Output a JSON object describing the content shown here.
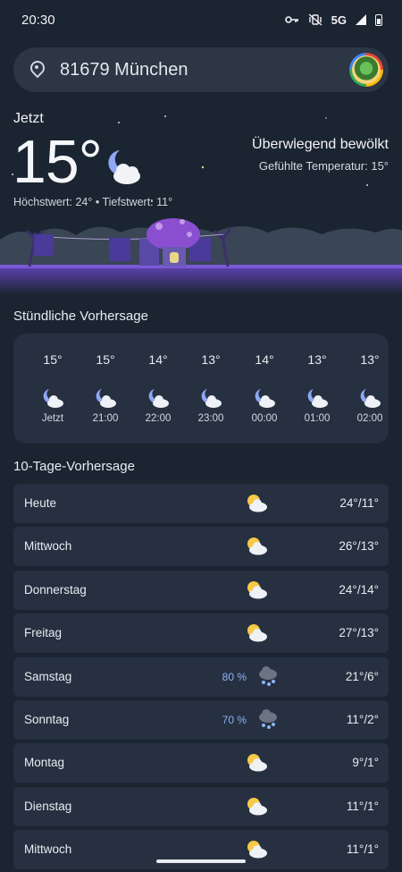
{
  "status": {
    "time": "20:30",
    "network": "5G"
  },
  "search": {
    "location": "81679 München"
  },
  "current": {
    "label": "Jetzt",
    "temp": "15°",
    "condition": "Überwiegend bewölkt",
    "feels_like": "Gefühlte Temperatur: 15°",
    "hilo": "Höchstwert: 24° • Tiefstwert: 11°"
  },
  "hourly": {
    "title": "Stündliche Vorhersage",
    "items": [
      {
        "temp": "15°",
        "time": "Jetzt",
        "icon": "moon-cloud-icon"
      },
      {
        "temp": "15°",
        "time": "21:00",
        "icon": "moon-cloud-icon"
      },
      {
        "temp": "14°",
        "time": "22:00",
        "icon": "moon-cloud-icon"
      },
      {
        "temp": "13°",
        "time": "23:00",
        "icon": "moon-cloud-icon"
      },
      {
        "temp": "14°",
        "time": "00:00",
        "icon": "moon-cloud-icon"
      },
      {
        "temp": "13°",
        "time": "01:00",
        "icon": "moon-cloud-icon"
      },
      {
        "temp": "13°",
        "time": "02:00",
        "icon": "moon-cloud-icon"
      }
    ]
  },
  "daily": {
    "title": "10-Tage-Vorhersage",
    "items": [
      {
        "day": "Heute",
        "temp": "24°/11°",
        "icon": "sun-cloud-icon",
        "precip": ""
      },
      {
        "day": "Mittwoch",
        "temp": "26°/13°",
        "icon": "sun-cloud-icon",
        "precip": ""
      },
      {
        "day": "Donnerstag",
        "temp": "24°/14°",
        "icon": "sun-cloud-icon",
        "precip": ""
      },
      {
        "day": "Freitag",
        "temp": "27°/13°",
        "icon": "sun-cloud-icon",
        "precip": ""
      },
      {
        "day": "Samstag",
        "temp": "21°/6°",
        "icon": "rain-cloud-icon",
        "precip": "80 %"
      },
      {
        "day": "Sonntag",
        "temp": "11°/2°",
        "icon": "rain-cloud-icon",
        "precip": "70 %"
      },
      {
        "day": "Montag",
        "temp": "9°/1°",
        "icon": "sun-cloud-icon",
        "precip": ""
      },
      {
        "day": "Dienstag",
        "temp": "11°/1°",
        "icon": "sun-cloud-icon",
        "precip": ""
      },
      {
        "day": "Mittwoch",
        "temp": "11°/1°",
        "icon": "sun-cloud-icon",
        "precip": ""
      }
    ]
  }
}
